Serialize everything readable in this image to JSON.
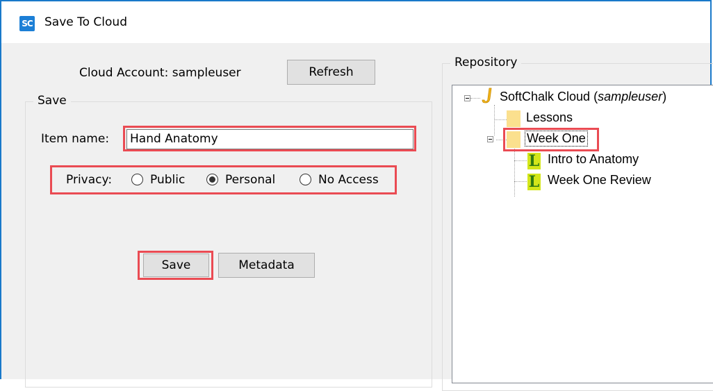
{
  "window": {
    "app_icon_text": "SC",
    "title": "Save To Cloud"
  },
  "account": {
    "label": "Cloud Account: sampleuser",
    "refresh_label": "Refresh"
  },
  "save_group": {
    "label": "Save",
    "item_name_label": "Item name:",
    "item_name_value": "Hand Anatomy",
    "privacy_label": "Privacy:",
    "privacy_options": [
      "Public",
      "Personal",
      "No Access"
    ],
    "privacy_selected": "Personal",
    "save_label": "Save",
    "metadata_label": "Metadata"
  },
  "repository": {
    "label": "Repository",
    "root": {
      "name": "SoftChalk Cloud",
      "user": "sampleuser"
    },
    "items": [
      {
        "label": "Lessons",
        "type": "folder"
      },
      {
        "label": "Week One",
        "type": "folder",
        "selected": true
      },
      {
        "label": "Intro to Anatomy",
        "type": "lesson"
      },
      {
        "label": "Week One Review",
        "type": "lesson"
      }
    ]
  },
  "colors": {
    "highlight": "#ea4b53",
    "window_border": "#1979ca",
    "folder": "#fbe08e",
    "lesson_icon": "#d3e61a"
  }
}
